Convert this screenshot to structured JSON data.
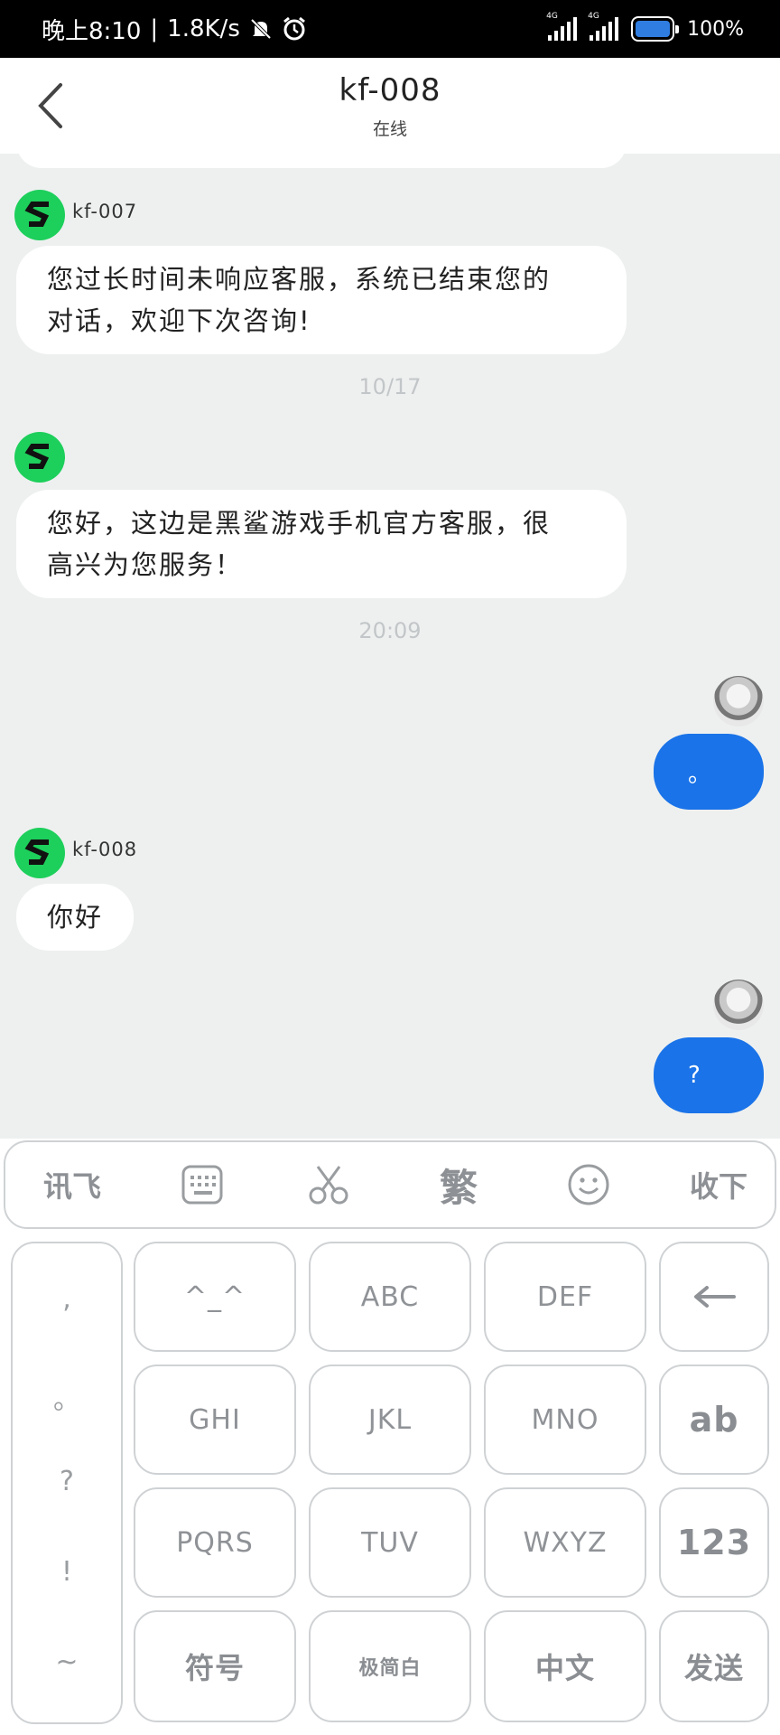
{
  "status_bar": {
    "time": "晚上8:10",
    "net_speed": "1.8K/s",
    "signal_labels": [
      "4G",
      "4G"
    ],
    "battery": "100%",
    "icons": [
      "mute-bell-icon",
      "alarm-clock-icon",
      "signal-icon",
      "battery-icon"
    ]
  },
  "header": {
    "title": "kf-008",
    "subtitle": "在线"
  },
  "messages": {
    "agent_1_name": "kf-007",
    "agent_1_text_line1": "您过长时间未响应客服，系统已结束您的",
    "agent_1_text_line2": "对话，欢迎下次咨询!",
    "date_1": "10/17",
    "greeting_line1": "您好，这边是黑鲨游戏手机官方客服，很",
    "greeting_line2": "高兴为您服务！",
    "time_1": "20:09",
    "user_1_text": "。",
    "agent_2_name": "kf-008",
    "agent_2_text": "你好",
    "user_2_text": "?"
  },
  "keyboard": {
    "toolbar": {
      "ime_label": "讯飞",
      "traditional_label": "繁",
      "collapse_label": "收下",
      "icons": [
        "keyboard-icon",
        "scissors-icon",
        "smiley-icon"
      ]
    },
    "punctuation": [
      ",",
      "。",
      "?",
      "!",
      "~"
    ],
    "keys": {
      "emoticon": "^_^",
      "abc": "ABC",
      "def": "DEF",
      "ghi": "GHI",
      "jkl": "JKL",
      "mno": "MNO",
      "pqrs": "PQRS",
      "tuv": "TUV",
      "wxyz": "WXYZ",
      "lang_ab": "ab",
      "num": "123",
      "symbols": "符号",
      "theme": "极简白",
      "chinese": "中文",
      "send": "发送"
    }
  },
  "colors": {
    "accent_blue": "#1a73e8",
    "brand_green": "#1dcf5b",
    "chat_bg": "#eef0f0"
  }
}
